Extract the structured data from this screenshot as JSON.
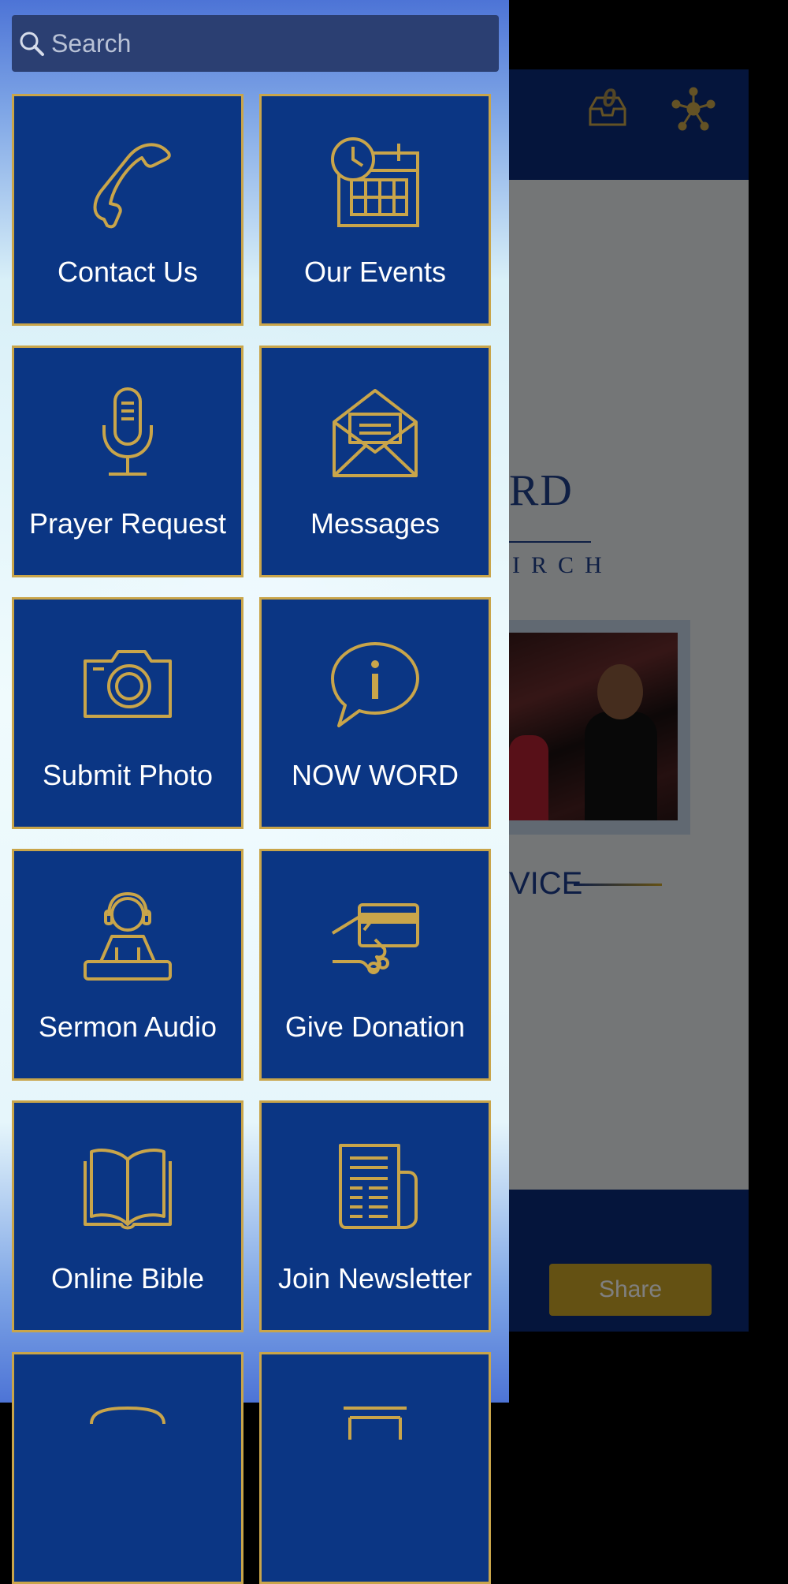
{
  "search": {
    "placeholder": "Search"
  },
  "background_app": {
    "inbox_count": "0",
    "logo_partial": "RD",
    "logo_sub_partial": "IRCH",
    "section_partial": "VICE",
    "share_label": "Share"
  },
  "tiles": [
    {
      "label": "Contact Us",
      "icon": "phone-icon"
    },
    {
      "label": "Our Events",
      "icon": "calendar-clock-icon"
    },
    {
      "label": "Prayer Request",
      "icon": "microphone-icon"
    },
    {
      "label": "Messages",
      "icon": "envelope-icon"
    },
    {
      "label": "Submit Photo",
      "icon": "camera-icon"
    },
    {
      "label": "NOW WORD",
      "icon": "info-bubble-icon"
    },
    {
      "label": "Sermon Audio",
      "icon": "headphones-person-icon"
    },
    {
      "label": "Give Donation",
      "icon": "hand-card-icon"
    },
    {
      "label": "Online Bible",
      "icon": "open-book-icon"
    },
    {
      "label": "Join Newsletter",
      "icon": "newspaper-icon"
    },
    {
      "label": "",
      "icon": "chat-icon"
    },
    {
      "label": "",
      "icon": "document-icon"
    }
  ],
  "colors": {
    "tile_bg": "#0b3684",
    "tile_border": "#c9a54a",
    "icon_gold": "#c9a54a",
    "search_bg": "#2b3f72"
  }
}
